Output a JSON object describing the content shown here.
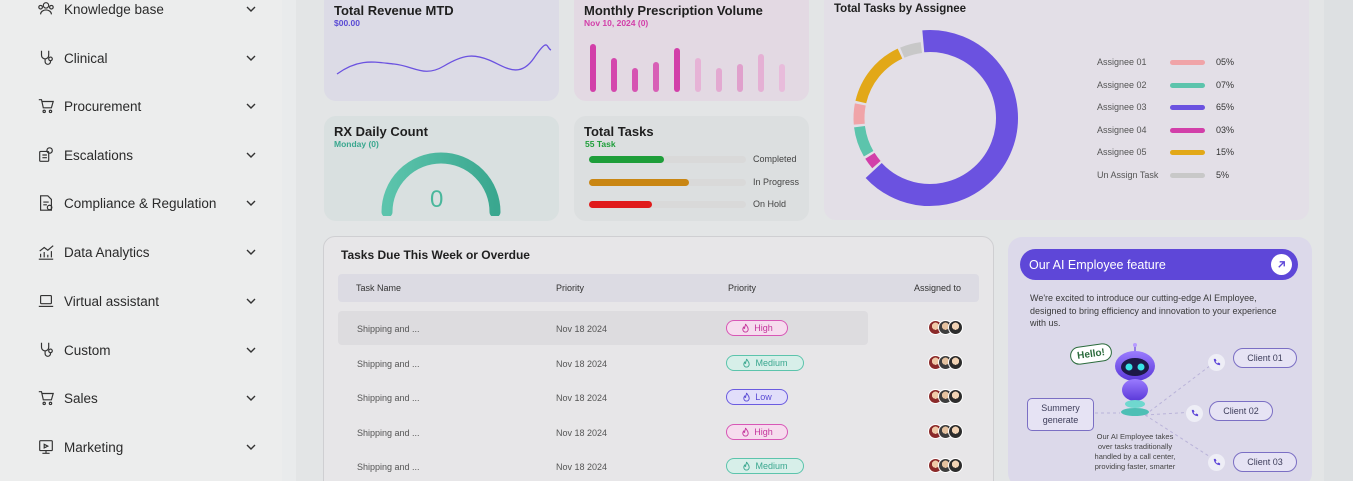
{
  "sidebar": {
    "items": [
      {
        "label": "Knowledge base",
        "icon": "users-icon"
      },
      {
        "label": "Clinical",
        "icon": "stethoscope-icon"
      },
      {
        "label": "Procurement",
        "icon": "cart-icon"
      },
      {
        "label": "Escalations",
        "icon": "escalation-icon"
      },
      {
        "label": "Compliance & Regulation",
        "icon": "compliance-doc-icon"
      },
      {
        "label": "Data Analytics",
        "icon": "analytics-chart-icon"
      },
      {
        "label": "Virtual assistant",
        "icon": "laptop-icon"
      },
      {
        "label": "Custom",
        "icon": "stethoscope-icon"
      },
      {
        "label": "Sales",
        "icon": "cart-icon"
      },
      {
        "label": "Marketing",
        "icon": "marketing-icon"
      }
    ]
  },
  "revenue": {
    "title": "Total Revenue MTD",
    "sub": "$00.00",
    "color": "#5a4bd4"
  },
  "prescription": {
    "title": "Monthly Prescription Volume",
    "sub": "Nov 10, 2024 (0)",
    "values": [
      48,
      34,
      24,
      30,
      44,
      34,
      24,
      28,
      38,
      28
    ]
  },
  "rx": {
    "title": "RX Daily Count",
    "sub": "Monday (0)",
    "value": "0"
  },
  "tasks": {
    "title": "Total Tasks",
    "sub": "55 Task",
    "bars": [
      {
        "label": "Completed",
        "fraction": 0.48,
        "color": "#1e9e3a"
      },
      {
        "label": "In Progress",
        "fraction": 0.64,
        "color": "#c98613"
      },
      {
        "label": "On Hold",
        "fraction": 0.4,
        "color": "#e01b1b"
      }
    ]
  },
  "chart_data": {
    "type": "pie",
    "title": "Total Tasks by Assignee",
    "series": [
      {
        "name": "Assignee 01",
        "label": "05%",
        "value": 5,
        "color": "#f0a4a8"
      },
      {
        "name": "Assignee 02",
        "label": "07%",
        "value": 7,
        "color": "#5cc4ac"
      },
      {
        "name": "Assignee 03",
        "label": "65%",
        "value": 65,
        "color": "#6b52e0"
      },
      {
        "name": "Assignee 04",
        "label": "03%",
        "value": 3,
        "color": "#d23fa9"
      },
      {
        "name": "Assignee 05",
        "label": "15%",
        "value": 15,
        "color": "#e2a818"
      },
      {
        "name": "Un Assign Task",
        "label": "5%",
        "value": 5,
        "color": "#c8c8c8"
      }
    ]
  },
  "table": {
    "title": "Tasks Due This Week or Overdue",
    "headers": [
      "Task Name",
      "Priority",
      "Priority",
      "Assigned to"
    ],
    "rows": [
      {
        "name": "Shipping and ...",
        "date": "Nov 18 2024",
        "priority": "High",
        "kind": "high"
      },
      {
        "name": "Shipping and ...",
        "date": "Nov 18 2024",
        "priority": "Medium",
        "kind": "medium"
      },
      {
        "name": "Shipping and ...",
        "date": "Nov 18 2024",
        "priority": "Low",
        "kind": "low"
      },
      {
        "name": "Shipping and ...",
        "date": "Nov 18 2024",
        "priority": "High",
        "kind": "high"
      },
      {
        "name": "Shipping and ...",
        "date": "Nov 18 2024",
        "priority": "Medium",
        "kind": "medium"
      }
    ]
  },
  "ai": {
    "title": "Our AI Employee feature",
    "text": "We're excited to introduce our cutting-edge AI Employee, designed to bring efficiency and innovation to your experience with us.",
    "hello": "Hello!",
    "summary": "Summery generate",
    "clients": [
      "Client 01",
      "Client 02",
      "Client 03"
    ],
    "desc": "Our AI Employee takes over tasks traditionally handled by a call center, providing faster, smarter"
  }
}
